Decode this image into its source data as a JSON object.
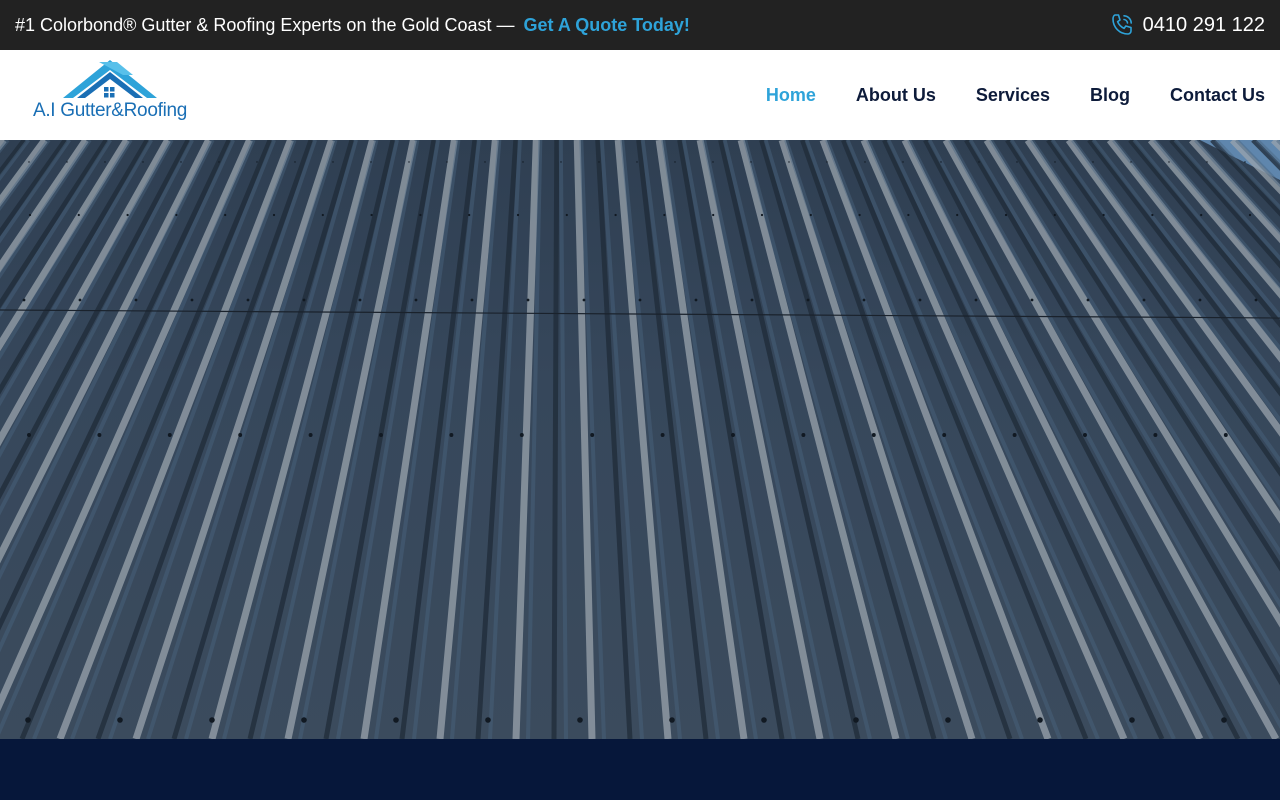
{
  "topbar": {
    "tagline": "#1 Colorbond® Gutter & Roofing Experts on the Gold Coast —",
    "cta": "Get A Quote Today!",
    "phone": "0410 291 122",
    "phone_icon": "phone-ringing-icon"
  },
  "logo": {
    "text": "A.I Gutter&Roofing",
    "icon": "house-roof-icon"
  },
  "nav": {
    "items": [
      "Home",
      "About Us",
      "Services",
      "Blog",
      "Contact Us"
    ],
    "active": "Home"
  },
  "hero": {
    "image": "corrugated-metal-roof-photo"
  },
  "colors": {
    "accent": "#2ea3d9",
    "topbar_bg": "#222222",
    "nav_text": "#0d1b3a",
    "footer_band": "#06173a"
  }
}
